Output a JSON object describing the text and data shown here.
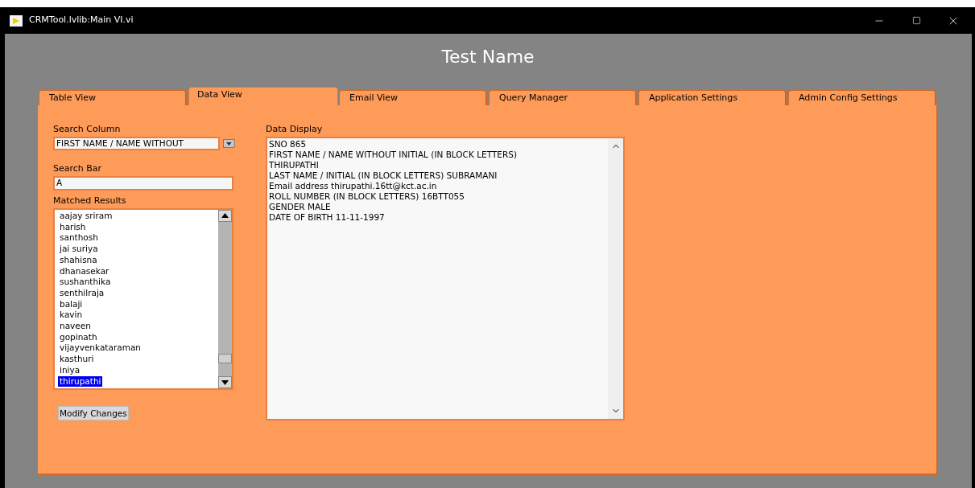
{
  "window": {
    "title": "CRMTool.lvlib:Main VI.vi"
  },
  "heading": "Test Name",
  "tabs": [
    {
      "label": "Table View",
      "selected": false
    },
    {
      "label": "Data View",
      "selected": true
    },
    {
      "label": "Email View",
      "selected": false
    },
    {
      "label": "Query Manager",
      "selected": false
    },
    {
      "label": "Application Settings",
      "selected": false
    },
    {
      "label": "Admin Config Settings",
      "selected": false
    }
  ],
  "search_column": {
    "label": "Search Column",
    "value": "FIRST NAME / NAME WITHOUT"
  },
  "search_bar": {
    "label": "Search Bar",
    "value": "A"
  },
  "matched_results": {
    "label": "Matched Results",
    "items": [
      {
        "name": "aajay sriram",
        "selected": false
      },
      {
        "name": "harish",
        "selected": false
      },
      {
        "name": "santhosh",
        "selected": false
      },
      {
        "name": "jai suriya",
        "selected": false
      },
      {
        "name": "shahisna",
        "selected": false
      },
      {
        "name": "dhanasekar",
        "selected": false
      },
      {
        "name": "sushanthika",
        "selected": false
      },
      {
        "name": "senthilraja",
        "selected": false
      },
      {
        "name": "balaji",
        "selected": false
      },
      {
        "name": "kavin",
        "selected": false
      },
      {
        "name": "naveen",
        "selected": false
      },
      {
        "name": "gopinath",
        "selected": false
      },
      {
        "name": "vijayvenkataraman",
        "selected": false
      },
      {
        "name": "kasthuri",
        "selected": false
      },
      {
        "name": "iniya",
        "selected": false
      },
      {
        "name": "thirupathi",
        "selected": true
      }
    ]
  },
  "modify_button": "Modify Changes",
  "data_display": {
    "label": "Data Display",
    "lines": [
      "SNO 865",
      "FIRST NAME / NAME WITHOUT INITIAL (IN BLOCK LETTERS)",
      "THIRUPATHI",
      "LAST NAME / INITIAL (IN BLOCK LETTERS) SUBRAMANI",
      "Email address thirupathi.16tt@kct.ac.in",
      "ROLL NUMBER (IN BLOCK LETTERS) 16BTT055",
      "GENDER MALE",
      "DATE OF BIRTH 11-11-1997"
    ]
  }
}
